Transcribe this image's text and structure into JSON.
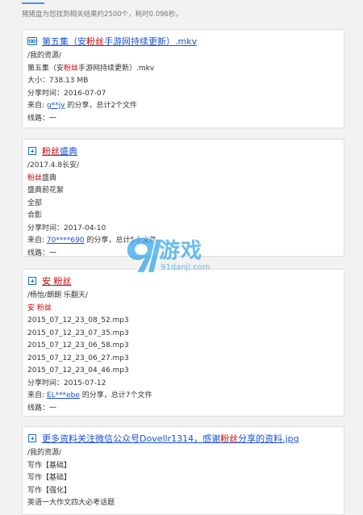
{
  "summary": "猪猪盘为您找到相关结果约2500个，耗时0.096秒。",
  "results": [
    {
      "title_pre": "第五集（安",
      "title_hl": "粉丝",
      "title_post": "手游网持续更新）.mkv",
      "path": "/我的资源/",
      "filename_pre": "第五集（安",
      "filename_hl": "粉丝",
      "filename_post": "手游网持续更新）.mkv",
      "size": "大小：738.13 MB",
      "share_time": "分享时间：2016-07-07",
      "from_label": "来自: ",
      "user": "g**jy",
      "from_suffix": " 的分享，总计2个文件",
      "route": "线路：一"
    },
    {
      "title_hl": "粉丝",
      "title_post": "盛典",
      "path": "/2017.4.8长安/",
      "line1_hl": "粉丝",
      "line1_post": "盛典",
      "line2": "盛典前花絮",
      "line3": "全部",
      "line4": "合影",
      "share_time": "分享时间：2017-04-10",
      "from_label": "来自: ",
      "user": "70****690",
      "from_suffix": " 的分享，总计5个文件",
      "route": "线路：一"
    },
    {
      "title_pre": "安 ",
      "title_hl": "粉丝",
      "path": "/杨怡/朗朗 乐翻天/",
      "line1": "安 粉丝",
      "files": [
        "2015_07_12_23_08_52.mp3",
        "2015_07_12_23_07_35.mp3",
        "2015_07_12_23_06_58.mp3",
        "2015_07_12_23_06_27.mp3",
        "2015_07_12_23_04_46.mp3"
      ],
      "share_time": "分享时间：2015-07-12",
      "from_label": "来自: ",
      "user": "EL***ebe",
      "from_suffix": " 的分享，总计7个文件",
      "route": "线路：一"
    },
    {
      "title_pre": "更多资料关注微信公众号Dovellr1314，感谢",
      "title_hl": "粉丝",
      "title_post": "分享的资料.jpg",
      "path": "/我的资源/",
      "lines": [
        "写作【基础】",
        "写作【基础】",
        "写作【强化】",
        "英语一大作文四大必考话题"
      ]
    }
  ],
  "watermark": {
    "big": "游戏",
    "small": "91danji.com",
    "brand_color": "#2aa0e8"
  },
  "colors": {
    "link": "#1a4fd6",
    "highlight": "#cc0000",
    "icon_blue": "#1a6fbf"
  }
}
